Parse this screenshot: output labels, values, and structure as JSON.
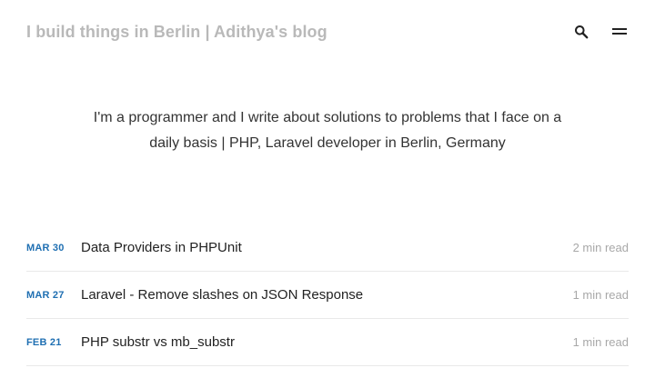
{
  "header": {
    "site_title": "I build things in Berlin | Adithya's blog",
    "search_icon": "search-icon",
    "menu_icon": "menu-icon"
  },
  "hero": {
    "tagline": "I'm a programmer and I write about solutions to problems that I face on a daily basis | PHP, Laravel developer in Berlin, Germany"
  },
  "posts": [
    {
      "month": "MAR",
      "day": "30",
      "title": "Data Providers in PHPUnit",
      "read_time": "2 min read"
    },
    {
      "month": "MAR",
      "day": "27",
      "title": "Laravel - Remove slashes on JSON Response",
      "read_time": "1 min read"
    },
    {
      "month": "FEB",
      "day": "21",
      "title": "PHP substr vs mb_substr",
      "read_time": "1 min read"
    }
  ],
  "colors": {
    "date_accent": "#1f6fb2",
    "site_title": "#b9b9b9",
    "read_time": "#a8a8a8",
    "divider": "#e9e9e9"
  }
}
